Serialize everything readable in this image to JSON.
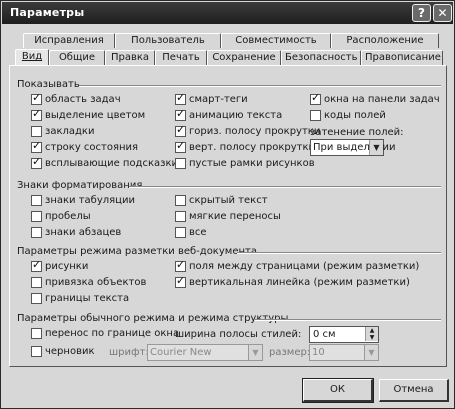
{
  "window": {
    "title": "Параметры",
    "help_label": "?",
    "close_label": "✕"
  },
  "tabs_row1": [
    {
      "label": "Исправления"
    },
    {
      "label": "Пользователь"
    },
    {
      "label": "Совместимость"
    },
    {
      "label": "Расположение"
    }
  ],
  "tabs_row2": [
    {
      "label": "Вид",
      "active": true
    },
    {
      "label": "Общие"
    },
    {
      "label": "Правка"
    },
    {
      "label": "Печать"
    },
    {
      "label": "Сохранение"
    },
    {
      "label": "Безопасность"
    },
    {
      "label": "Правописание"
    }
  ],
  "show": {
    "title": "Показывать",
    "items": [
      {
        "label": "область задач",
        "checked": true
      },
      {
        "label": "выделение цветом",
        "checked": true
      },
      {
        "label": "закладки",
        "checked": false
      },
      {
        "label": "строку состояния",
        "checked": true
      },
      {
        "label": "всплывающие подсказки",
        "checked": true
      },
      {
        "label": "смарт-теги",
        "checked": true
      },
      {
        "label": "анимацию текста",
        "checked": true
      },
      {
        "label": "гориз. полосу прокрутки",
        "checked": true
      },
      {
        "label": "верт. полосу прокрутки",
        "checked": true
      },
      {
        "label": "пустые рамки рисунков",
        "checked": false
      },
      {
        "label": "окна на панели задач",
        "checked": true
      },
      {
        "label": "коды полей",
        "checked": false
      }
    ],
    "shading_label": "затенение полей:",
    "shading_value": "При выделении"
  },
  "formatting": {
    "title": "Знаки форматирования",
    "items": [
      {
        "label": "знаки табуляции",
        "checked": false
      },
      {
        "label": "пробелы",
        "checked": false
      },
      {
        "label": "знаки абзацев",
        "checked": false
      },
      {
        "label": "скрытый текст",
        "checked": false
      },
      {
        "label": "мягкие переносы",
        "checked": false
      },
      {
        "label": "все",
        "checked": false
      }
    ]
  },
  "layout": {
    "title": "Параметры режима разметки веб-документа",
    "items": [
      {
        "label": "рисунки",
        "checked": true
      },
      {
        "label": "привязка объектов",
        "checked": false
      },
      {
        "label": "границы текста",
        "checked": false
      },
      {
        "label": "поля между страницами (режим разметки)",
        "checked": true
      },
      {
        "label": "вертикальная линейка (режим разметки)",
        "checked": true
      }
    ]
  },
  "normal": {
    "title": "Параметры обычного режима и режима структуры",
    "wrap_label": "перенос по границе окна",
    "draft_label": "черновик",
    "style_width_label": "ширина полосы стилей:",
    "style_width_value": "0 см",
    "font_label": "шрифт:",
    "font_value": "Courier New",
    "size_label": "размер:",
    "size_value": "10"
  },
  "buttons": {
    "ok": "ОК",
    "cancel": "Отмена"
  }
}
